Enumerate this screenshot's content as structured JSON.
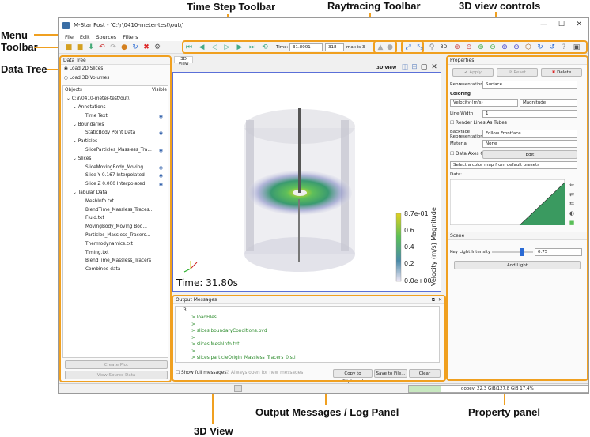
{
  "annotations": {
    "time_step_toolbar": "Time Step Toolbar",
    "raytracing_toolbar": "Raytracing Toolbar",
    "view_controls": "3D view controls",
    "menu": "Menu",
    "toolbar": "Toolbar",
    "data_tree": "Data Tree",
    "output_messages": "Output Messages / Log Panel",
    "property_panel": "Property panel",
    "view_3d": "3D View"
  },
  "window": {
    "title": "M-Star Post - 'C:\\r\\0410-meter-test\\out\\'",
    "menu": [
      "File",
      "Edit",
      "Sources",
      "Filters"
    ]
  },
  "time_toolbar": {
    "time_label": "Time:",
    "time_value": "31.8001",
    "step_value": "318",
    "max_label": "max is 3"
  },
  "data_tree": {
    "title": "Data Tree",
    "radio_2d": "Load 2D Slices",
    "radio_3d": "Load 3D Volumes",
    "col_objects": "Objects",
    "col_visible": "Visible",
    "root": "C:/r/0410-meter-test/out\\",
    "items": [
      {
        "label": "Annotations",
        "level": 1,
        "eye": false
      },
      {
        "label": "Time Text",
        "level": 2,
        "eye": true
      },
      {
        "label": "Boundaries",
        "level": 1,
        "eye": false
      },
      {
        "label": "StaticBody Point Data",
        "level": 2,
        "eye": true
      },
      {
        "label": "Particles",
        "level": 1,
        "eye": false
      },
      {
        "label": "SliceParticles_Massless_Tra...",
        "level": 2,
        "eye": true
      },
      {
        "label": "Slices",
        "level": 1,
        "eye": false
      },
      {
        "label": "SliceMovingBody_Moving ...",
        "level": 2,
        "eye": true
      },
      {
        "label": "Slice Y 0.167 Interpolated",
        "level": 2,
        "eye": true
      },
      {
        "label": "Slice Z 0.000 Interpolated",
        "level": 2,
        "eye": true
      },
      {
        "label": "Tabular Data",
        "level": 1,
        "eye": false
      },
      {
        "label": "MeshInfo.txt",
        "level": 2,
        "eye": false
      },
      {
        "label": "BlendTime_Massless_Traces...",
        "level": 2,
        "eye": false
      },
      {
        "label": "Fluid.txt",
        "level": 2,
        "eye": false
      },
      {
        "label": "MovingBody_Moving Bod...",
        "level": 2,
        "eye": false
      },
      {
        "label": "Particles_Massless_Tracers...",
        "level": 2,
        "eye": false
      },
      {
        "label": "Thermodynamics.txt",
        "level": 2,
        "eye": false
      },
      {
        "label": "Timing.txt",
        "level": 2,
        "eye": false
      },
      {
        "label": "BlendTime_Massless_Tracers",
        "level": 2,
        "eye": false
      },
      {
        "label": "Combined data",
        "level": 2,
        "eye": false
      }
    ],
    "create_plot": "Create Plot",
    "view_source": "View Source Data"
  },
  "view3d": {
    "tab": "3D View",
    "link": "3D View",
    "time_text": "Time: 31.80s",
    "colorbar_title": "Velocity (m/s) Magnitude",
    "colorbar_ticks": [
      "8.7e-01",
      "0.6",
      "0.4",
      "0.2",
      "0.0e+00"
    ],
    "colors": {
      "high": "#e0d020",
      "mid": "#3aa86a",
      "low": "#e8e0f0"
    }
  },
  "output": {
    "title": "Output Messages",
    "line_num": "3",
    "lines": [
      "loadFiles",
      "",
      "slices.boundaryConditions.pvd",
      "",
      "slices.MeshInfo.txt",
      "",
      "slices.particleOrigin_Massless_Tracers_0.stl"
    ],
    "show_full": "Show full messages",
    "always_open": "Always open for new messages",
    "copy": "Copy to Clipboard",
    "save": "Save to File...",
    "clear": "Clear"
  },
  "properties": {
    "title": "Properties",
    "apply": "Apply",
    "reset": "Reset",
    "delete": "Delete",
    "representation_label": "Representation",
    "representation_value": "Surface",
    "coloring_label": "Coloring",
    "coloring_value": "Velocity (m/s)",
    "coloring_mode": "Magnitude",
    "line_width_label": "Line Width",
    "line_width_value": "1",
    "render_tubes": "Render Lines As Tubes",
    "backface_label": "Backface Representation",
    "backface_value": "Follow Frontface",
    "material_label": "Material",
    "material_value": "None",
    "axes_grid": "Data Axes Grid",
    "edit": "Edit",
    "preset_placeholder": "Select a color map from default presets",
    "data_label": "Data:",
    "scene_title": "Scene",
    "key_light_label": "Key Light Intensity",
    "key_light_value": "0.75",
    "key_light_level": 0.75,
    "add_light": "Add Light"
  },
  "status": {
    "memory": "gooey: 22.3 GiB/127.8 GiB 17.4%"
  }
}
